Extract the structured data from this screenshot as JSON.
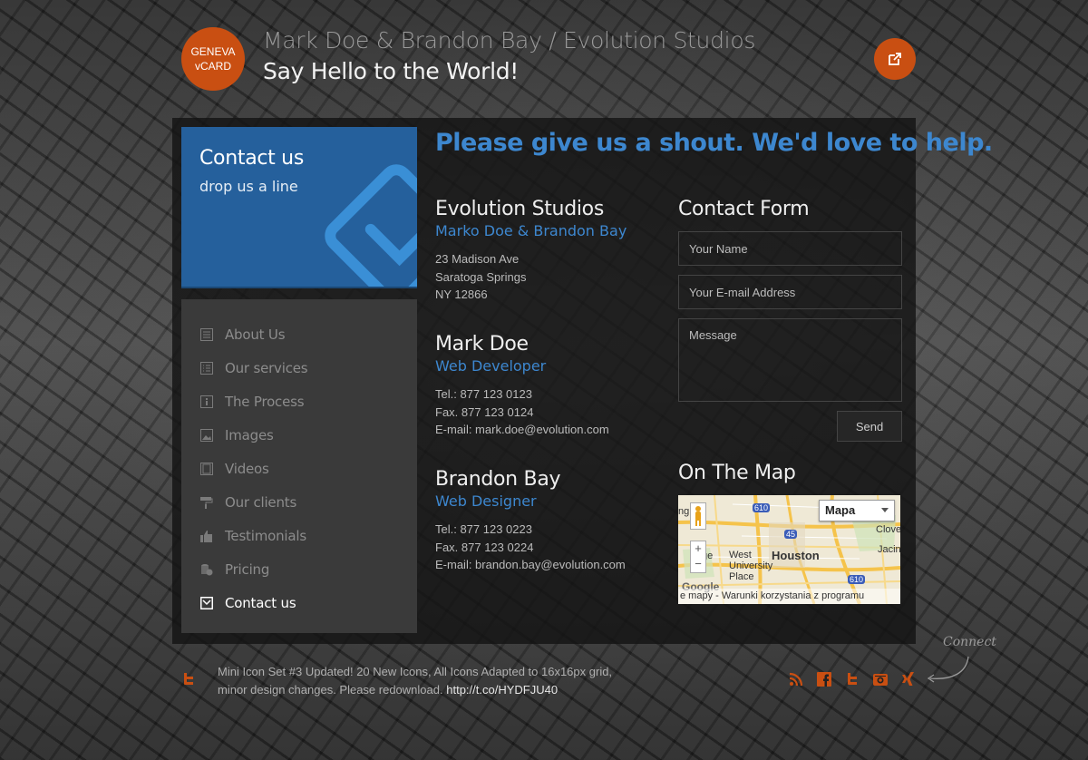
{
  "header": {
    "logo_line1": "GENEVA",
    "logo_line2": "vCARD",
    "title": "Mark Doe & Brandon Bay / Evolution Studios",
    "tagline": "Say Hello to the World!",
    "accent": "#c94f12"
  },
  "hero": {
    "title": "Contact us",
    "subtitle": "drop us a line",
    "color": "#25609c"
  },
  "nav": {
    "items": [
      {
        "label": "About Us",
        "icon": "list-icon"
      },
      {
        "label": "Our services",
        "icon": "list-icon"
      },
      {
        "label": "The Process",
        "icon": "info-icon"
      },
      {
        "label": "Images",
        "icon": "image-icon"
      },
      {
        "label": "Videos",
        "icon": "video-icon"
      },
      {
        "label": "Our clients",
        "icon": "roller-icon"
      },
      {
        "label": "Testimonials",
        "icon": "thumbs-up-icon"
      },
      {
        "label": "Pricing",
        "icon": "coins-icon"
      },
      {
        "label": "Contact us",
        "icon": "envelope-icon",
        "active": true
      }
    ]
  },
  "main": {
    "headline": "Please give us a shout. We'd love to help.",
    "studio": {
      "title": "Evolution Studios",
      "subtitle": "Marko Doe & Brandon Bay",
      "line1": "23 Madison Ave",
      "line2": "Saratoga Springs",
      "line3": "NY 12866"
    },
    "person1": {
      "name": "Mark Doe",
      "role": "Web Developer",
      "tel": "Tel.: 877 123 0123",
      "fax": "Fax. 877 123 0124",
      "email": "E-mail: mark.doe@evolution.com"
    },
    "person2": {
      "name": "Brandon Bay",
      "role": "Web Designer",
      "tel": "Tel.: 877 123 0223",
      "fax": "Fax. 877 123 0224",
      "email": "E-mail: brandon.bay@evolution.com"
    }
  },
  "form": {
    "title": "Contact Form",
    "name_placeholder": "Your Name",
    "email_placeholder": "Your E-mail Address",
    "message_placeholder": "Message",
    "send_label": "Send"
  },
  "map": {
    "title": "On The Map",
    "type_select": "Mapa",
    "labels": [
      "Houston",
      "West University Place",
      "Clove",
      "Jacin",
      "ng",
      "ey",
      "ge"
    ],
    "shields": [
      "610",
      "45",
      "610"
    ],
    "footer": "e mapy - Warunki korzystania z programu",
    "logo": "Google"
  },
  "footer": {
    "tweet_text": "Mini Icon Set #3 Updated! 20 New Icons, All Icons Adapted to 16x16px grid, minor design changes. Please redownload.",
    "tweet_link": "http://t.co/HYDFJU40",
    "connect_label": "Connect",
    "social": [
      "rss-icon",
      "facebook-icon",
      "twitter-icon",
      "camera-icon",
      "xing-icon"
    ]
  }
}
